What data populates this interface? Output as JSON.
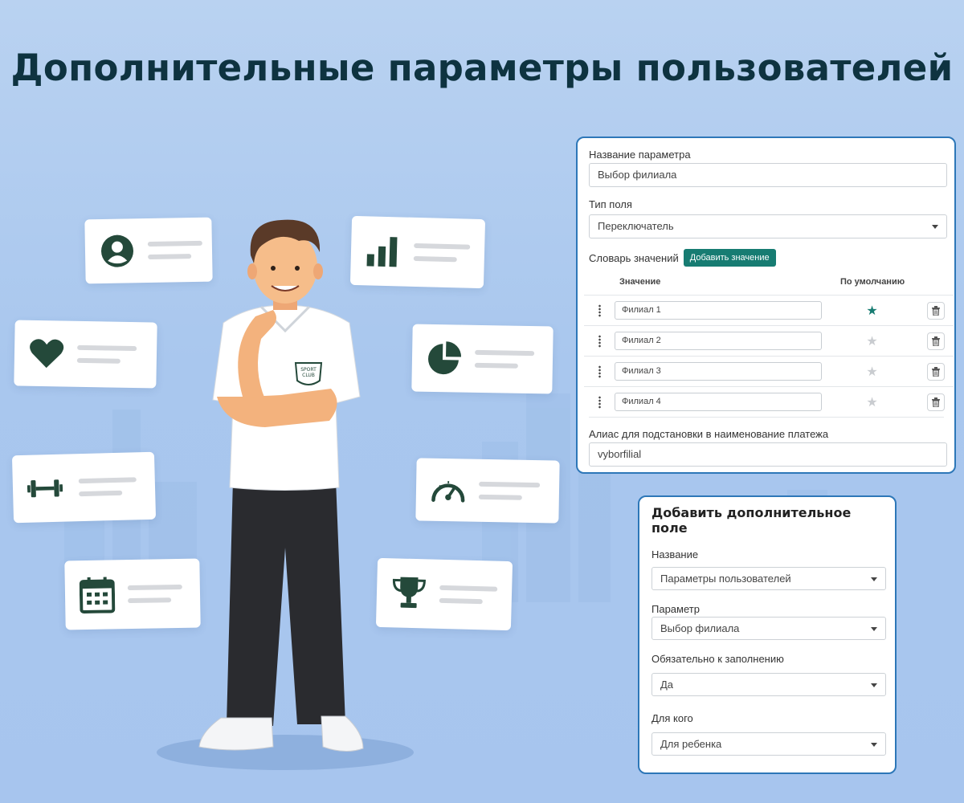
{
  "headline": "Дополнительные параметры пользователей",
  "feature_cards": [
    {
      "icon": "user-avatar-icon"
    },
    {
      "icon": "bar-chart-icon"
    },
    {
      "icon": "heart-icon"
    },
    {
      "icon": "pie-chart-icon"
    },
    {
      "icon": "dumbbell-icon"
    },
    {
      "icon": "speedometer-icon"
    },
    {
      "icon": "calendar-icon"
    },
    {
      "icon": "trophy-icon"
    }
  ],
  "character": {
    "shirt_badge_top": "SPORT",
    "shirt_badge_bottom": "CLUB"
  },
  "settings_panel": {
    "name_label": "Название параметра",
    "name_value": "Выбор филиала",
    "type_label": "Тип поля",
    "type_value": "Переключатель",
    "dictionary_label": "Словарь значений",
    "add_value_button": "Добавить значение",
    "col_value": "Значение",
    "col_default": "По умолчанию",
    "values": [
      {
        "label": "Филиал 1",
        "is_default": true
      },
      {
        "label": "Филиал 2",
        "is_default": false
      },
      {
        "label": "Филиал 3",
        "is_default": false
      },
      {
        "label": "Филиал 4",
        "is_default": false
      }
    ],
    "alias_label": "Алиас для подстановки в наименование платежа",
    "alias_value": "vyborfilial"
  },
  "add_field_panel": {
    "title": "Добавить дополнительное поле",
    "name_label": "Название",
    "name_value": "Параметры пользователей",
    "param_label": "Параметр",
    "param_value": "Выбор филиала",
    "required_label": "Обязательно к заполнению",
    "required_value": "Да",
    "for_whom_label": "Для кого",
    "for_whom_value": "Для ребенка"
  },
  "colors": {
    "accent": "#177c72",
    "panel_border": "#2d77b8",
    "icon": "#24493a",
    "headline": "#0e3340",
    "star_active": "#177c72",
    "star_inactive": "#c9ccd0"
  }
}
